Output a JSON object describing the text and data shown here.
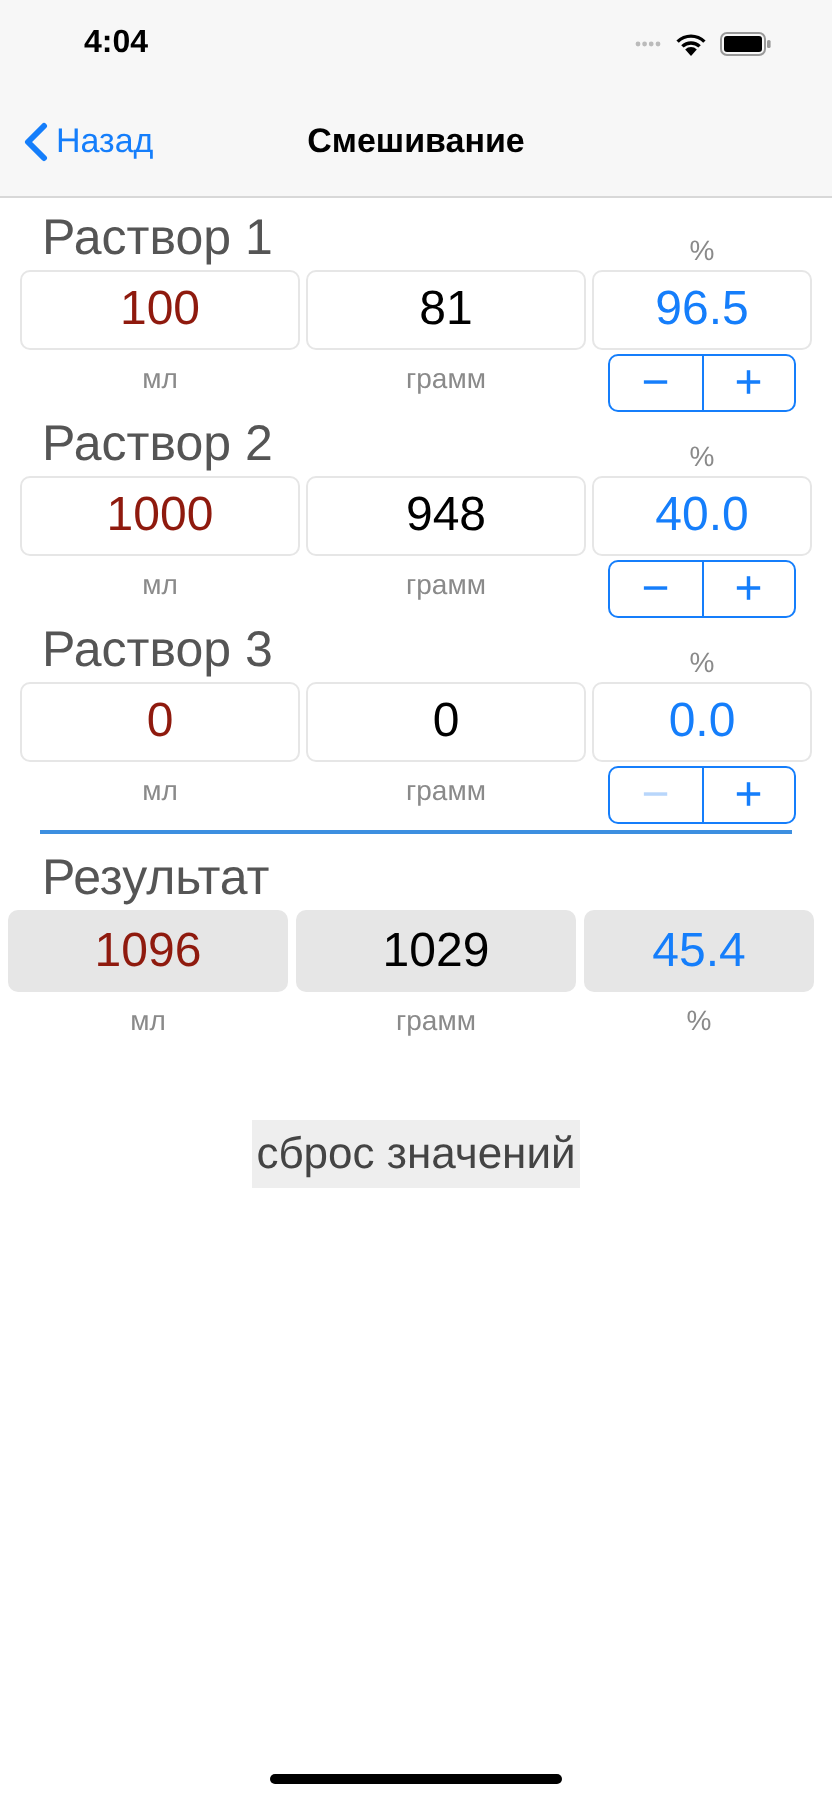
{
  "status_bar": {
    "time": "4:04"
  },
  "nav": {
    "back": "Назад",
    "title": "Смешивание"
  },
  "solutions": [
    {
      "title": "Раствор 1",
      "percent_label": "%",
      "ml": "100",
      "ml_label": "мл",
      "gram": "81",
      "gram_label": "грамм",
      "percent": "96.5",
      "stepper": {
        "minus": "−",
        "plus": "+",
        "minus_disabled": false
      }
    },
    {
      "title": "Раствор 2",
      "percent_label": "%",
      "ml": "1000",
      "ml_label": "мл",
      "gram": "948",
      "gram_label": "грамм",
      "percent": "40.0",
      "stepper": {
        "minus": "−",
        "plus": "+",
        "minus_disabled": false
      }
    },
    {
      "title": "Раствор 3",
      "percent_label": "%",
      "ml": "0",
      "ml_label": "мл",
      "gram": "0",
      "gram_label": "грамм",
      "percent": "0.0",
      "stepper": {
        "minus": "−",
        "plus": "+",
        "minus_disabled": true
      }
    }
  ],
  "result": {
    "title": "Результат",
    "ml": "1096",
    "ml_label": "мл",
    "gram": "1029",
    "gram_label": "грамм",
    "percent": "45.4",
    "percent_label": "%"
  },
  "reset_button": "сброс значений"
}
